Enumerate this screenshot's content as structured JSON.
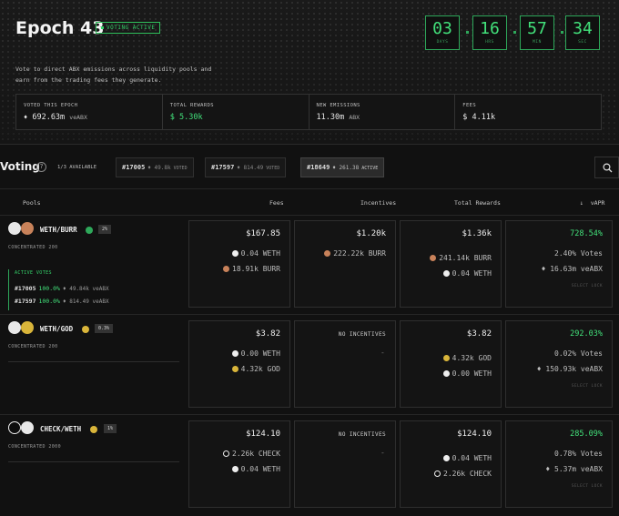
{
  "header": {
    "title": "Epoch 43",
    "status_badge": "VOTING ACTIVE",
    "countdown": [
      {
        "value": "03",
        "unit": "DAYS"
      },
      {
        "value": "16",
        "unit": "HRS"
      },
      {
        "value": "57",
        "unit": "MIN"
      },
      {
        "value": "34",
        "unit": "SEC"
      }
    ],
    "description_line1": "Vote to direct ABX emissions across liquidity pools and",
    "description_line2": "earn from the trading fees they generate.",
    "stats": [
      {
        "label": "VOTED THIS EPOCH",
        "icon": "drop-icon",
        "value": "692.63m",
        "unit": "veABX"
      },
      {
        "label": "TOTAL REWARDS",
        "value": "$ 5.30k"
      },
      {
        "label": "NEW EMISSIONS",
        "value": "11.30m",
        "unit": "ABX"
      },
      {
        "label": "FEES",
        "value": "$ 4.11k"
      }
    ]
  },
  "voting": {
    "title": "Voting",
    "available": "1/3 AVAILABLE",
    "tabs": [
      {
        "id": "#17005",
        "amount": "49.8k",
        "status": "VOTED"
      },
      {
        "id": "#17597",
        "amount": "814.49",
        "status": "VOTED"
      },
      {
        "id": "#18649",
        "amount": "261.38",
        "status": "ACTIVE"
      }
    ]
  },
  "columns": {
    "pools": "Pools",
    "fees": "Fees",
    "incentives": "Incentives",
    "total_rewards": "Total Rewards",
    "vapr": "vAPR",
    "sort_arrow": "↓"
  },
  "pools": [
    {
      "name": "WETH/BURR",
      "fee": "2%",
      "type": "CONCENTRATED 200",
      "fees_total": "$167.85",
      "fees_lines": [
        "0.04 WETH",
        "18.91k BURR"
      ],
      "incentives_total": "$1.20k",
      "incentives_lines": [
        "222.22k BURR"
      ],
      "rewards_total": "$1.36k",
      "rewards_lines": [
        "241.14k BURR",
        "0.04 WETH"
      ],
      "apr": "728.54%",
      "votes_pct": "2.40% Votes",
      "votes_amt": "16.63m veABX",
      "lock_label": "SELECT LOCK",
      "active_votes": {
        "label": "ACTIVE VOTES",
        "rows": [
          {
            "id": "#17005",
            "pct": "100.0%",
            "amount": "49.84k veABX"
          },
          {
            "id": "#17597",
            "pct": "100.0%",
            "amount": "814.49 veABX"
          }
        ]
      }
    },
    {
      "name": "WETH/GOD",
      "fee": "0.3%",
      "type": "CONCENTRATED 200",
      "fees_total": "$3.82",
      "fees_lines": [
        "0.00 WETH",
        "4.32k GOD"
      ],
      "incentives_none": "NO INCENTIVES",
      "incentives_dash": "-",
      "rewards_total": "$3.82",
      "rewards_lines": [
        "4.32k GOD",
        "0.00 WETH"
      ],
      "apr": "292.03%",
      "votes_pct": "0.02% Votes",
      "votes_amt": "150.93k veABX",
      "lock_label": "SELECT LOCK"
    },
    {
      "name": "CHECK/WETH",
      "fee": "1%",
      "type": "CONCENTRATED 2000",
      "fees_total": "$124.10",
      "fees_lines": [
        "2.26k CHECK",
        "0.04 WETH"
      ],
      "incentives_none": "NO INCENTIVES",
      "incentives_dash": "-",
      "rewards_total": "$124.10",
      "rewards_lines": [
        "0.04 WETH",
        "2.26k CHECK"
      ],
      "apr": "285.09%",
      "votes_pct": "0.78% Votes",
      "votes_amt": "5.37m veABX",
      "lock_label": "SELECT LOCK"
    }
  ],
  "colors": {
    "accent": "#42e07a",
    "background": "#111111",
    "panel": "#141414",
    "burr": "#c8825a",
    "god": "#d9b53a",
    "weth": "#e6e6e6"
  }
}
